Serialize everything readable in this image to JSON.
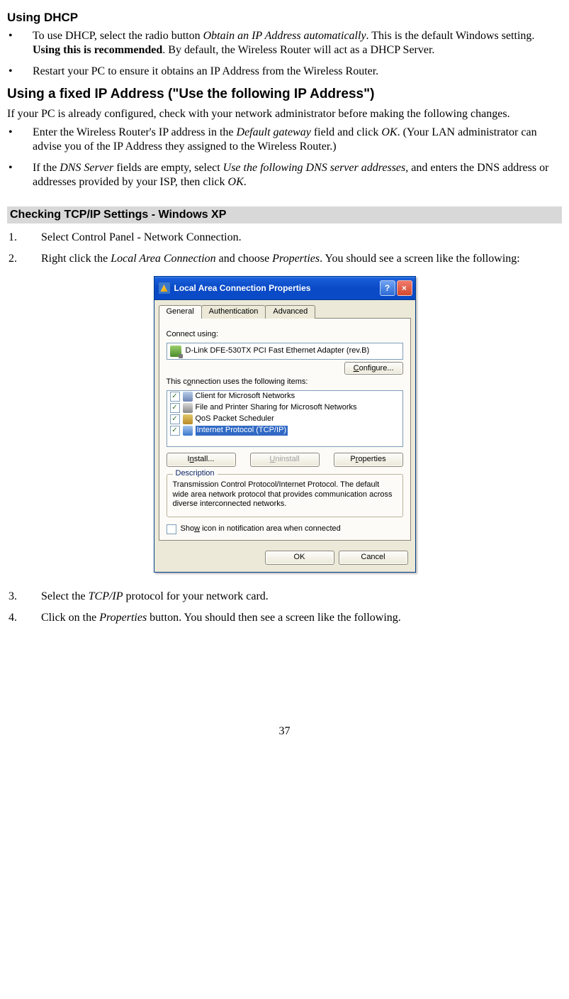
{
  "h_dhcp": "Using DHCP",
  "dhcp_b1_a": "To use DHCP, select the radio button ",
  "dhcp_b1_i": "Obtain an IP Address automatically",
  "dhcp_b1_b": ". This is the default Windows setting. ",
  "dhcp_b1_bold": "Using this is recommended",
  "dhcp_b1_c": ". By default, the Wireless Router will act as a DHCP Server.",
  "dhcp_b2": "Restart your PC to ensure it obtains an IP Address from the Wireless Router.",
  "h_fixed": "Using a fixed IP Address (\"Use the following IP Address\")",
  "fixed_p": "If your PC is already configured, check with your network administrator before making the following changes.",
  "fixed_b1_a": "Enter the Wireless Router's IP address in the ",
  "fixed_b1_i": "Default gateway",
  "fixed_b1_b": " field and click ",
  "fixed_b1_i2": "OK",
  "fixed_b1_c": ". (Your LAN administrator can advise you of the IP Address they assigned to the Wireless Router.)",
  "fixed_b2_a": "If the ",
  "fixed_b2_i": "DNS Server",
  "fixed_b2_b": " fields are empty, select ",
  "fixed_b2_i2": "Use the following DNS server addresses",
  "fixed_b2_c": ", and enters the DNS address or addresses provided by your ISP, then click ",
  "fixed_b2_i3": "OK",
  "fixed_b2_d": ".",
  "sec_bar": "Checking TCP/IP Settings - Windows XP",
  "step1": "Select Control Panel - Network Connection.",
  "step2_a": "Right click the ",
  "step2_i": "Local Area Connection",
  "step2_b": " and choose ",
  "step2_i2": "Properties",
  "step2_c": ". You should see a screen like the following:",
  "step3_a": "Select the ",
  "step3_i": "TCP/IP",
  "step3_b": " protocol for your network card.",
  "step4_a": "Click on the ",
  "step4_i": "Properties",
  "step4_b": " button. You should then see a screen like the following.",
  "page_num": "37",
  "dialog": {
    "title": "Local Area Connection Properties",
    "tabs": {
      "general": "General",
      "auth": "Authentication",
      "adv": "Advanced"
    },
    "connect_using": "Connect using:",
    "adapter": "D-Link DFE-530TX PCI Fast Ethernet Adapter (rev.B)",
    "configure": "Configure...",
    "uses_items": "This connection uses the following items:",
    "items": {
      "client": "Client for Microsoft Networks",
      "fps": "File and Printer Sharing for Microsoft Networks",
      "qos": "QoS Packet Scheduler",
      "tcp": "Internet Protocol (TCP/IP)"
    },
    "install": "Install...",
    "uninstall": "Uninstall",
    "properties": "Properties",
    "desc_legend": "Description",
    "desc_text": "Transmission Control Protocol/Internet Protocol. The default wide area network protocol that provides communication across diverse interconnected networks.",
    "show_icon": "Show icon in notification area when connected",
    "ok": "OK",
    "cancel": "Cancel"
  }
}
